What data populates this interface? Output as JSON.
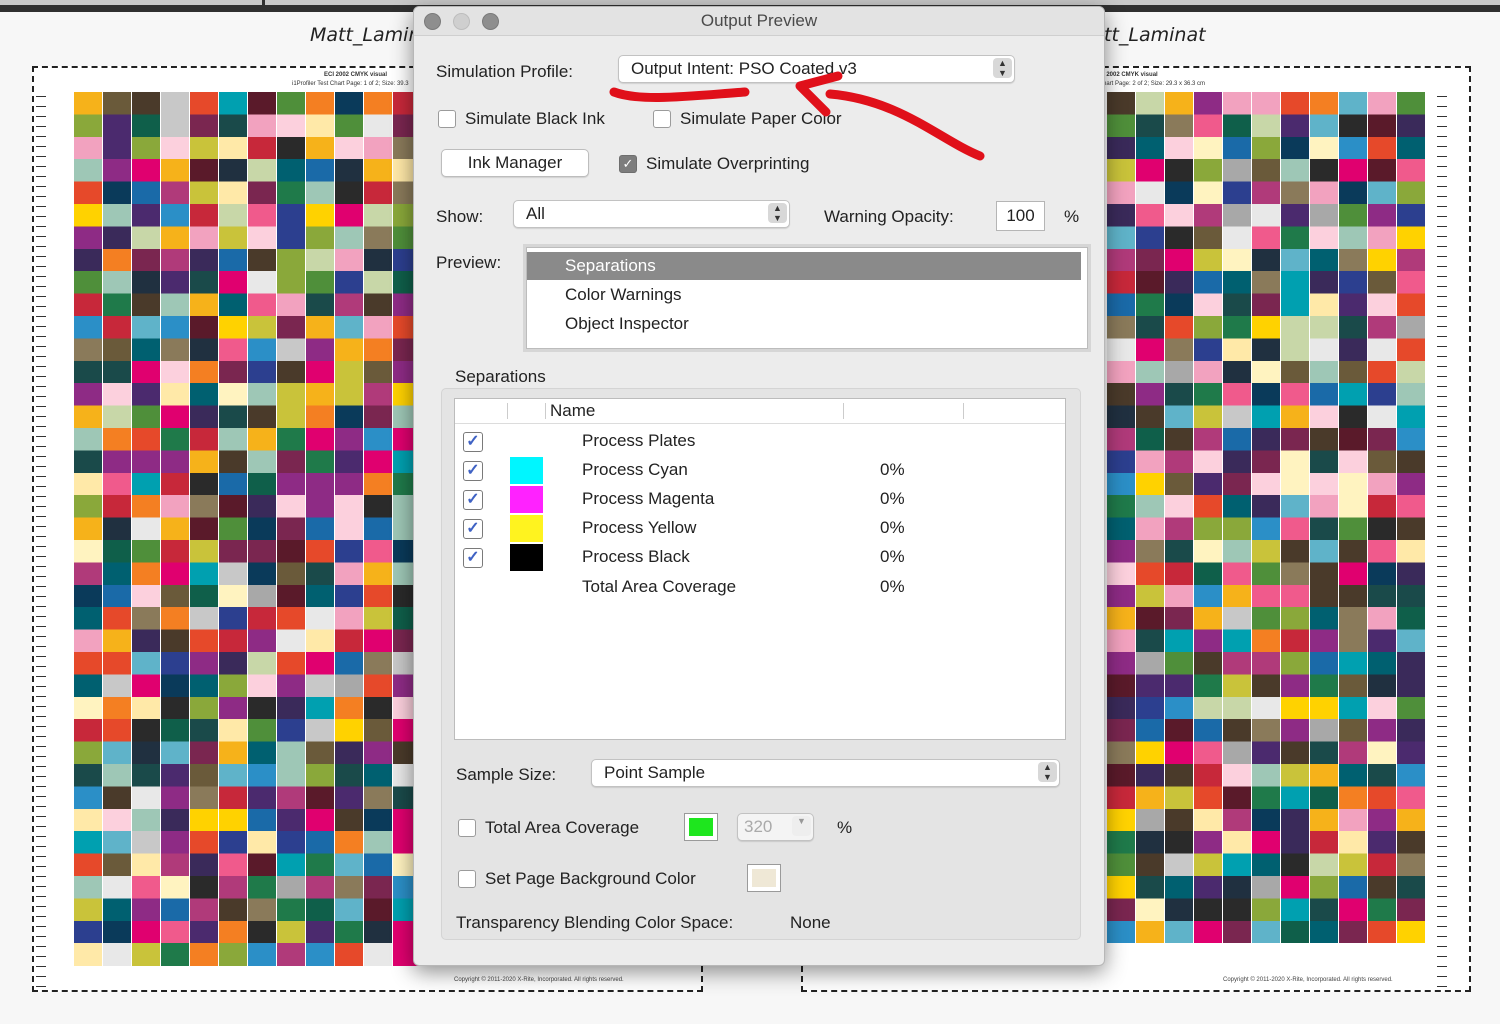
{
  "background_doc": {
    "left_title": "Matt_Lamina",
    "right_title": "tt_Laminat",
    "left_chart_header": "ECI 2002 CMYK visual",
    "left_chart_subheader": "i1Profiler Test Chart Page: 1 of 2; Size: 39.3",
    "right_chart_header": "I 2002 CMYK visual",
    "right_chart_subheader": "hart Page: 2 of 2; Size: 29.3 x 36.3 cm",
    "left_copyright": "Copyright © 2011-2020 X-Rite, Incorporated. All rights reserved.",
    "right_copyright": "Copyright © 2011-2020 X-Rite, Incorporated. All rights reserved."
  },
  "dialog": {
    "title": "Output Preview",
    "simulation_profile_label": "Simulation Profile:",
    "simulation_profile_value": "Output Intent: PSO Coated v3",
    "simulate_black_ink": {
      "label": "Simulate Black Ink",
      "checked": false
    },
    "simulate_paper_color": {
      "label": "Simulate Paper Color",
      "checked": false
    },
    "ink_manager_label": "Ink Manager",
    "simulate_overprinting": {
      "label": "Simulate Overprinting",
      "checked": true
    },
    "show_label": "Show:",
    "show_value": "All",
    "warning_opacity_label": "Warning Opacity:",
    "warning_opacity_value": "100",
    "percent": "%",
    "preview_label": "Preview:",
    "preview_items": [
      "Separations",
      "Color Warnings",
      "Object Inspector"
    ],
    "preview_selected": "Separations",
    "separations_label": "Separations",
    "table_header_name": "Name",
    "separations": [
      {
        "name": "Process Plates",
        "percent": "",
        "swatch": ""
      },
      {
        "name": "Process Cyan",
        "percent": "0%",
        "swatch": "#00f6ff"
      },
      {
        "name": "Process Magenta",
        "percent": "0%",
        "swatch": "#ff22ff"
      },
      {
        "name": "Process Yellow",
        "percent": "0%",
        "swatch": "#fff31f"
      },
      {
        "name": "Process Black",
        "percent": "0%",
        "swatch": "#000000"
      },
      {
        "name": "Total Area Coverage",
        "percent": "0%",
        "swatch": ""
      }
    ],
    "sample_size_label": "Sample Size:",
    "sample_size_value": "Point Sample",
    "total_area_coverage": {
      "label": "Total Area Coverage",
      "checked": false,
      "value": "320",
      "swatch": "#1ee61e"
    },
    "page_background": {
      "label": "Set Page Background Color",
      "checked": false,
      "swatch": "#efe8d6"
    },
    "blending_label": "Transparency Blending Color Space:",
    "blending_value": "None"
  },
  "annotation_color": "#e0101a"
}
